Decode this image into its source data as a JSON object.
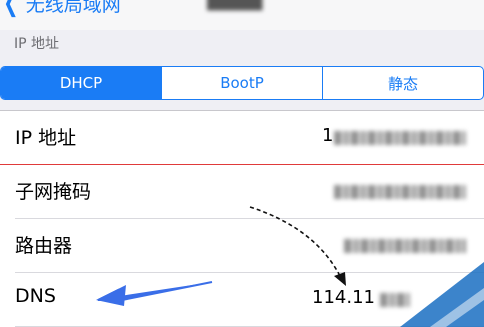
{
  "navbar": {
    "back_label": "无线局域网",
    "title": "",
    "back_icon": "chevron-left-icon"
  },
  "section": {
    "header": "IP 地址"
  },
  "segments": {
    "items": [
      "DHCP",
      "BootP",
      "静态"
    ],
    "selected": "DHCP"
  },
  "rows": [
    {
      "label": "IP 地址",
      "value_visible_prefix": "1"
    },
    {
      "label": "子网掩码"
    },
    {
      "label": "路由器"
    },
    {
      "label": "DNS",
      "value_visible": "114.11"
    }
  ],
  "colors": {
    "accent": "#1a7cf5",
    "annotation_arrow": "#3a6ee8",
    "separator_highlight": "#e03a3a"
  }
}
